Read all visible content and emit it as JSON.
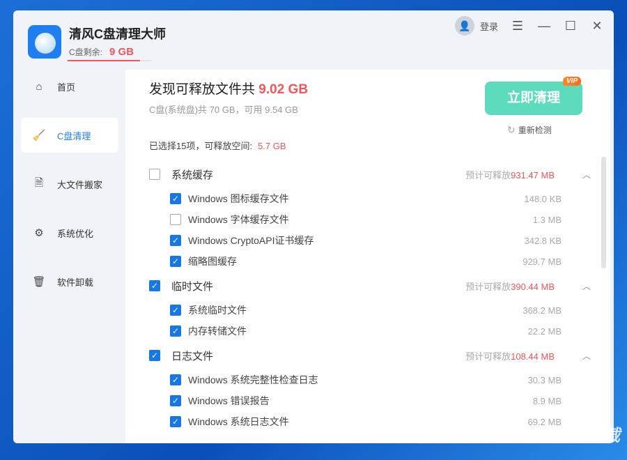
{
  "app": {
    "title": "清风C盘清理大师",
    "free_label": "C盘剩余:",
    "free_value": "9 GB",
    "login": "登录"
  },
  "sidebar": [
    {
      "label": "首页",
      "icon": "home-icon"
    },
    {
      "label": "C盘清理",
      "icon": "broom-icon"
    },
    {
      "label": "大文件搬家",
      "icon": "file-icon"
    },
    {
      "label": "系统优化",
      "icon": "gear-icon"
    },
    {
      "label": "软件卸载",
      "icon": "trash-icon"
    }
  ],
  "main": {
    "headline": "发现可释放文件共",
    "headline_value": "9.02 GB",
    "disk_info": "C盘(系统盘)共 70 GB，可用 9.54 GB",
    "selected": "已选择15项，可释放空间:",
    "selected_value": "5.7 GB",
    "clean_button": "立即清理",
    "vip": "VIP",
    "rescan": "重新检测",
    "est_label": "预计可释放"
  },
  "groups": [
    {
      "name": "系统缓存",
      "checked": false,
      "est": "931.47 MB",
      "items": [
        {
          "name": "Windows 图标缓存文件",
          "size": "148.0 KB",
          "checked": true
        },
        {
          "name": "Windows 字体缓存文件",
          "size": "1.3 MB",
          "checked": false
        },
        {
          "name": "Windows CryptoAPI证书缓存",
          "size": "342.8 KB",
          "checked": true
        },
        {
          "name": "缩略图缓存",
          "size": "929.7 MB",
          "checked": true
        }
      ]
    },
    {
      "name": "临时文件",
      "checked": true,
      "est": "390.44 MB",
      "items": [
        {
          "name": "系统临时文件",
          "size": "368.2 MB",
          "checked": true
        },
        {
          "name": "内存转储文件",
          "size": "22.2 MB",
          "checked": true
        }
      ]
    },
    {
      "name": "日志文件",
      "checked": true,
      "est": "108.44 MB",
      "items": [
        {
          "name": "Windows 系统完整性检查日志",
          "size": "30.3 MB",
          "checked": true
        },
        {
          "name": "Windows 错误报告",
          "size": "8.9 MB",
          "checked": true
        },
        {
          "name": "Windows 系统日志文件",
          "size": "69.2 MB",
          "checked": true
        }
      ]
    }
  ],
  "watermark": "KK下载"
}
